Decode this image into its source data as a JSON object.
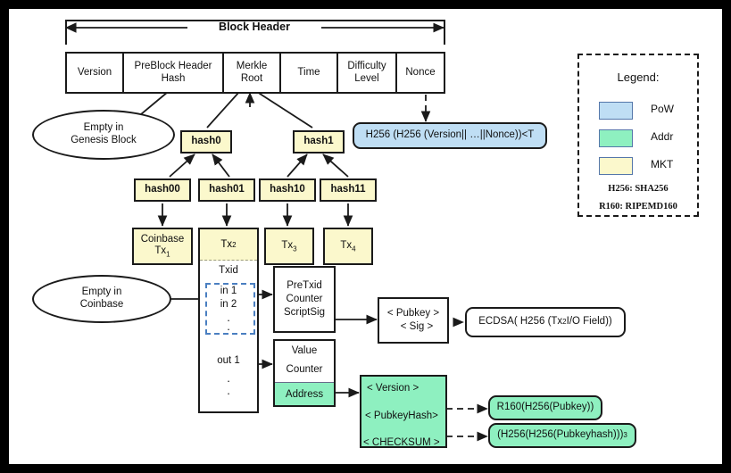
{
  "diagram": {
    "title_bar": "Block Header",
    "header_cells": [
      {
        "label": "Version",
        "type": "plain"
      },
      {
        "label": "PreBlock Header\nHash",
        "type": "plain"
      },
      {
        "label": "Merkle\nRoot",
        "type": "mkt"
      },
      {
        "label": "Time",
        "type": "plain"
      },
      {
        "label": "Difficulty\nLevel",
        "type": "plain"
      },
      {
        "label": "Nonce",
        "type": "pow"
      }
    ],
    "pow_formula": "H256 (H256 (Version|| …||Nonce))<T",
    "ellipses": [
      {
        "name": "genesis",
        "line1": "Empty in",
        "line2": "Genesis Block"
      },
      {
        "name": "coinbase",
        "line1": "Empty in",
        "line2": "Coinbase"
      }
    ],
    "merkle": {
      "level1": [
        "hash0",
        "hash1"
      ],
      "level2": [
        "hash00",
        "hash01",
        "hash10",
        "hash11"
      ],
      "transactions": [
        {
          "line1": "Coinbase",
          "line2": "Tx",
          "sub": "1"
        },
        {
          "line1": "",
          "line2": "Tx",
          "sub": "2"
        },
        {
          "line1": "",
          "line2": "Tx",
          "sub": "3"
        },
        {
          "line1": "",
          "line2": "Tx",
          "sub": "4"
        }
      ]
    },
    "tx_detail": {
      "txid_label": "Txid",
      "inputs": [
        "in 1",
        "in 2",
        ".",
        "."
      ],
      "outputs": [
        "out 1",
        ".",
        "."
      ]
    },
    "input_box": {
      "lines": [
        "PreTxid",
        "Counter",
        "ScriptSig"
      ]
    },
    "script_box": {
      "lines": [
        "< Pubkey >",
        "< Sig >"
      ]
    },
    "ecdsa_box": {
      "text": "ECDSA( H256 (Tx",
      "sub": "2",
      "text2": " I/O Field))"
    },
    "output_box": {
      "lines": [
        "Value",
        "Counter"
      ],
      "address": "Address"
    },
    "address_box": {
      "lines": [
        "< Version >",
        "< PubkeyHash>",
        "< CHECKSUM >"
      ]
    },
    "r160_box": {
      "text": "R160(H256(Pubkey))"
    },
    "checksum_box": {
      "text": "(H256(H256(Pubkeyhash)))",
      "sub": "3"
    }
  },
  "legend": {
    "title": "Legend:",
    "items": [
      {
        "label": "PoW",
        "color": "#bfdef4"
      },
      {
        "label": "Addr",
        "color": "#8ef0c0"
      },
      {
        "label": "MKT",
        "color": "#fbf8cc"
      }
    ],
    "notes": [
      "H256: SHA256",
      "R160: RIPEMD160"
    ]
  }
}
